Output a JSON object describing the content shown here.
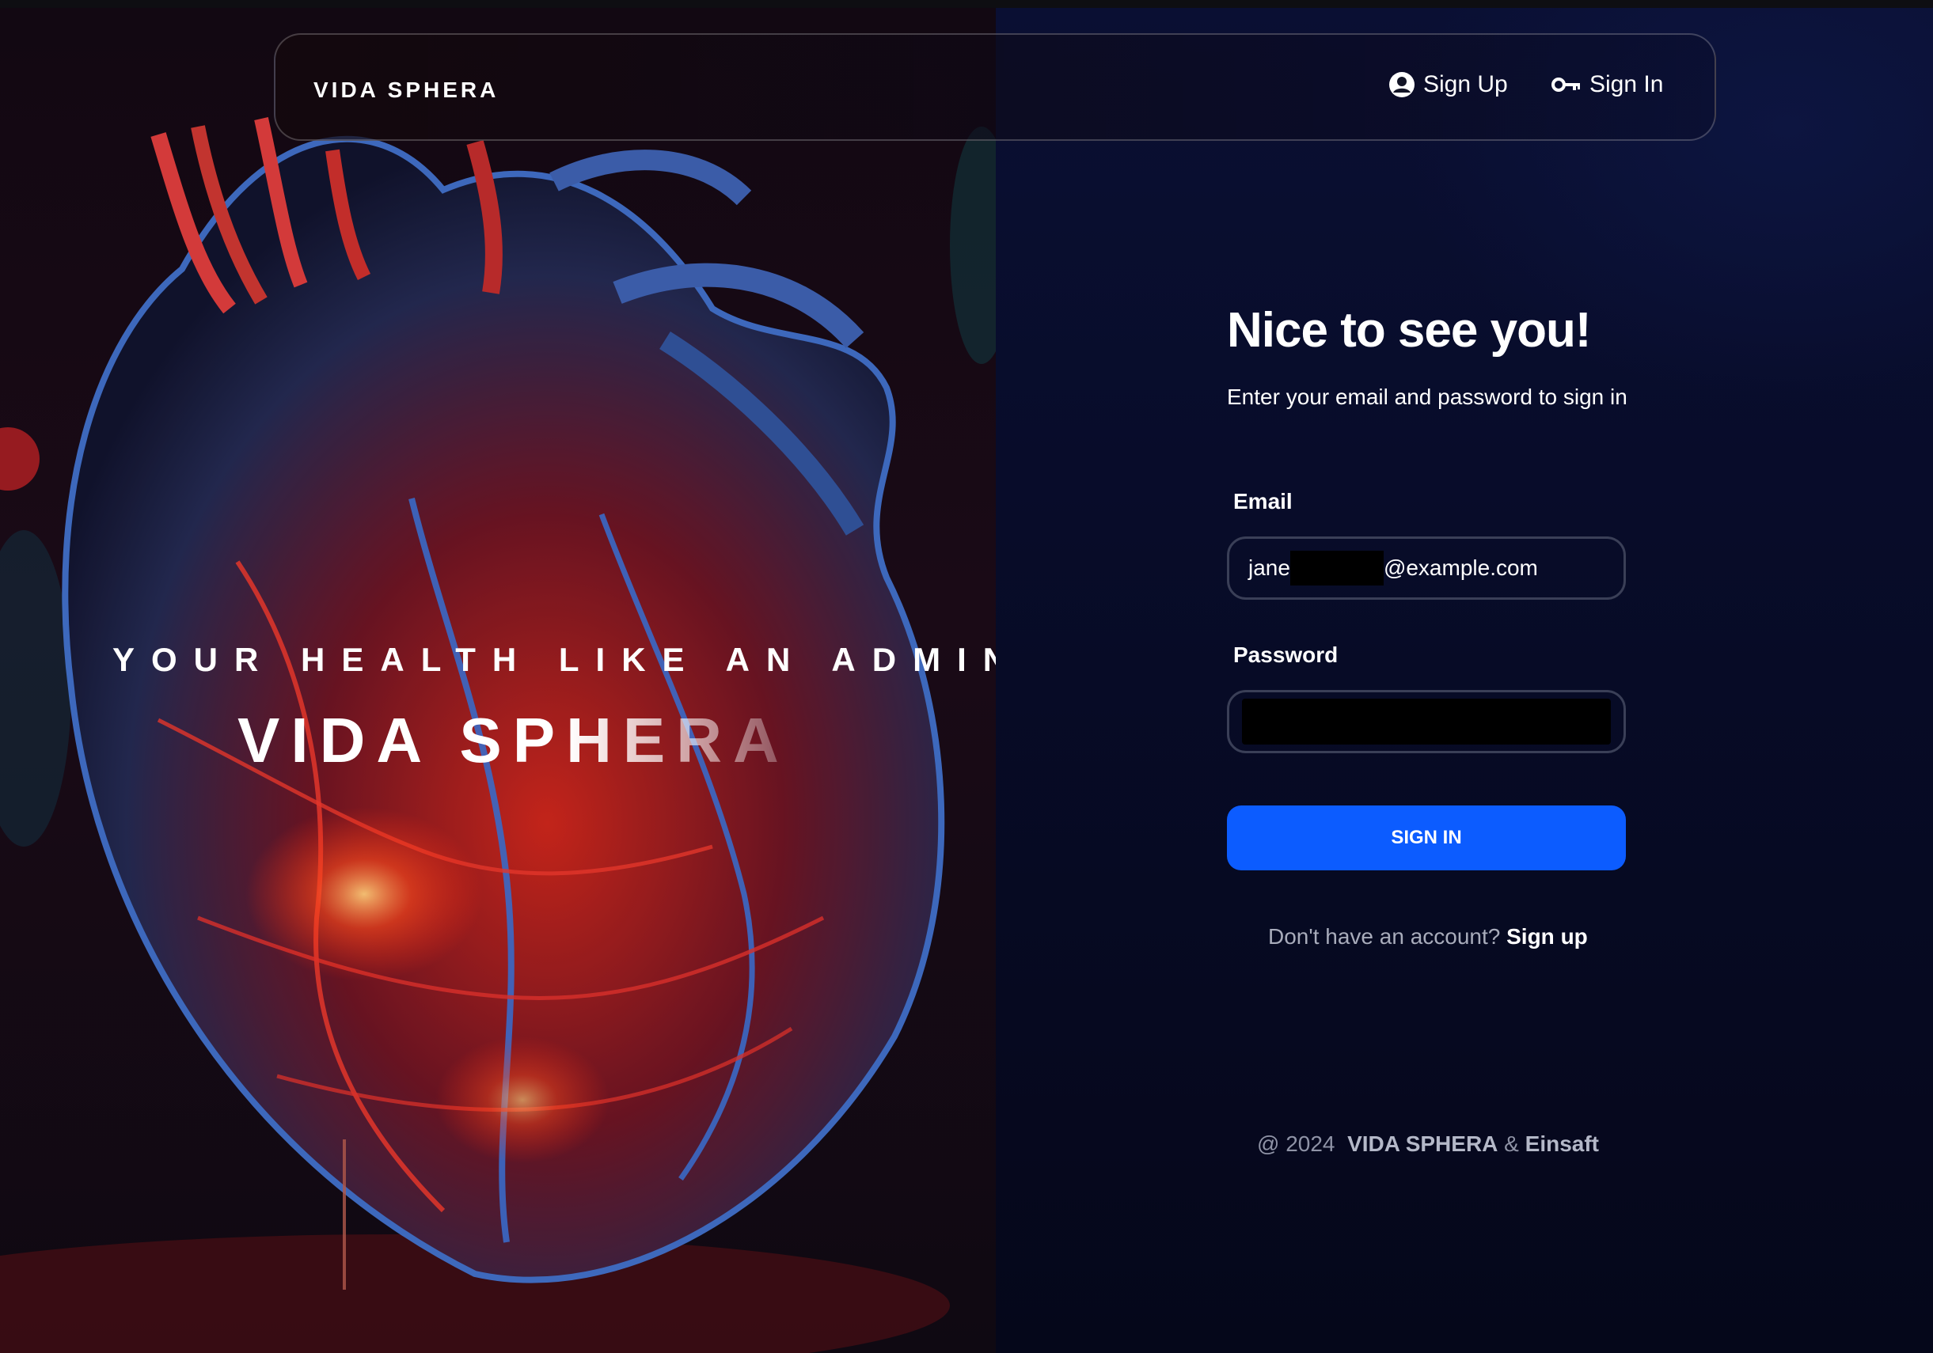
{
  "navbar": {
    "brand": "VIDA SPHERA",
    "sign_up": "Sign Up",
    "sign_in": "Sign In"
  },
  "hero": {
    "tagline": "YOUR HEALTH LIKE AN ADMIN",
    "title": "VIDA SPHERA"
  },
  "form": {
    "heading": "Nice to see you!",
    "subtitle": "Enter your email and password to sign in",
    "email_label": "Email",
    "email_prefix": "jane",
    "email_suffix": "@example.com",
    "password_label": "Password",
    "submit": "SIGN IN",
    "no_account": "Don't have an account?",
    "signup_link": "Sign up"
  },
  "footer": {
    "year": "@ 2024",
    "brand": "VIDA SPHERA",
    "amp": "&",
    "partner": "Einsaft"
  },
  "icons": {
    "sign_up": "user-circle-icon",
    "sign_in": "key-icon"
  },
  "colors": {
    "accent": "#0c5cff",
    "background": "#070a1f"
  }
}
